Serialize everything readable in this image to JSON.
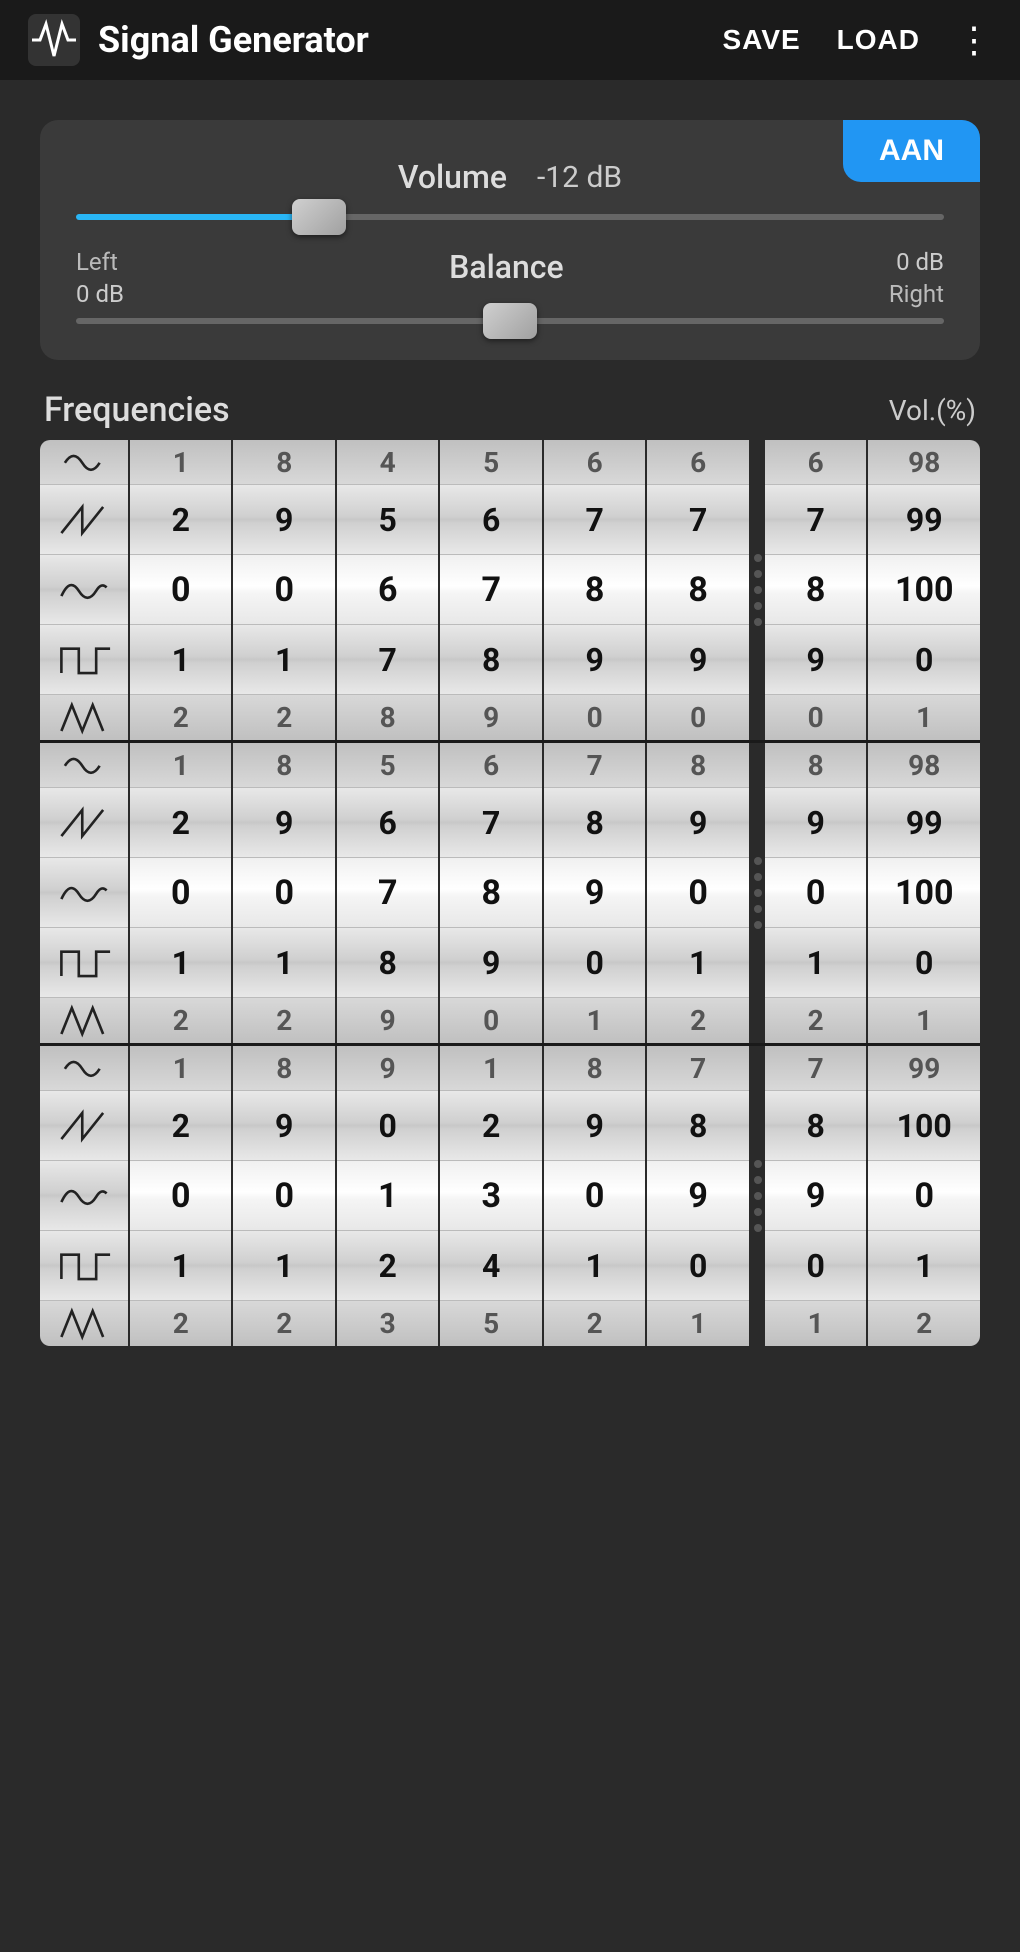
{
  "app": {
    "title": "Signal Generator",
    "save_label": "SAVE",
    "load_label": "LOAD"
  },
  "controls": {
    "aan_label": "AAN",
    "volume_label": "Volume",
    "volume_value": "-12 dB",
    "volume_slider_pct": 28,
    "balance_label": "Balance",
    "balance_left_label": "Left",
    "balance_left_db": "0 dB",
    "balance_right_label": "Right",
    "balance_right_db": "0 dB",
    "balance_pct": 50
  },
  "frequencies_title": "Frequencies",
  "vol_pct_title": "Vol.(%)",
  "groups": [
    {
      "rows": [
        {
          "wave": "partial-sine",
          "digits": [
            "1",
            "8",
            "4",
            "5",
            "6",
            "6"
          ],
          "vol_digit": "6",
          "vol_pct": "98",
          "partial": "top"
        },
        {
          "wave": "sawtooth",
          "digits": [
            "2",
            "9",
            "5",
            "6",
            "7",
            "7"
          ],
          "vol_digit": "7",
          "vol_pct": "99",
          "partial": "none"
        },
        {
          "wave": "sine",
          "digits": [
            "0",
            "0",
            "6",
            "7",
            "8",
            "8"
          ],
          "vol_digit": "8",
          "vol_pct": "100",
          "partial": "none"
        },
        {
          "wave": "square",
          "digits": [
            "1",
            "1",
            "7",
            "8",
            "9",
            "9"
          ],
          "vol_digit": "9",
          "vol_pct": "0",
          "partial": "none"
        },
        {
          "wave": "triangle",
          "digits": [
            "2",
            "2",
            "8",
            "9",
            "0",
            "0"
          ],
          "vol_digit": "0",
          "vol_pct": "1",
          "partial": "bottom"
        }
      ]
    },
    {
      "rows": [
        {
          "wave": "partial-sine",
          "digits": [
            "1",
            "8",
            "5",
            "6",
            "7",
            "8"
          ],
          "vol_digit": "8",
          "vol_pct": "98",
          "partial": "top"
        },
        {
          "wave": "sawtooth",
          "digits": [
            "2",
            "9",
            "6",
            "7",
            "8",
            "9"
          ],
          "vol_digit": "9",
          "vol_pct": "99",
          "partial": "none"
        },
        {
          "wave": "sine",
          "digits": [
            "0",
            "0",
            "7",
            "8",
            "9",
            "0"
          ],
          "vol_digit": "0",
          "vol_pct": "100",
          "partial": "none"
        },
        {
          "wave": "square",
          "digits": [
            "1",
            "1",
            "8",
            "9",
            "0",
            "1"
          ],
          "vol_digit": "1",
          "vol_pct": "0",
          "partial": "none"
        },
        {
          "wave": "triangle",
          "digits": [
            "2",
            "2",
            "9",
            "0",
            "1",
            "2"
          ],
          "vol_digit": "2",
          "vol_pct": "1",
          "partial": "bottom"
        }
      ]
    },
    {
      "rows": [
        {
          "wave": "partial-sine",
          "digits": [
            "1",
            "8",
            "9",
            "1",
            "8",
            "7"
          ],
          "vol_digit": "7",
          "vol_pct": "99",
          "partial": "top"
        },
        {
          "wave": "sawtooth",
          "digits": [
            "2",
            "9",
            "0",
            "2",
            "9",
            "8"
          ],
          "vol_digit": "8",
          "vol_pct": "100",
          "partial": "none"
        },
        {
          "wave": "sine",
          "digits": [
            "0",
            "0",
            "1",
            "3",
            "0",
            "9"
          ],
          "vol_digit": "9",
          "vol_pct": "0",
          "partial": "none"
        },
        {
          "wave": "square",
          "digits": [
            "1",
            "1",
            "2",
            "4",
            "1",
            "0"
          ],
          "vol_digit": "0",
          "vol_pct": "1",
          "partial": "none"
        },
        {
          "wave": "triangle",
          "digits": [
            "2",
            "2",
            "3",
            "5",
            "2",
            "1"
          ],
          "vol_digit": "1",
          "vol_pct": "2",
          "partial": "bottom"
        }
      ]
    }
  ]
}
